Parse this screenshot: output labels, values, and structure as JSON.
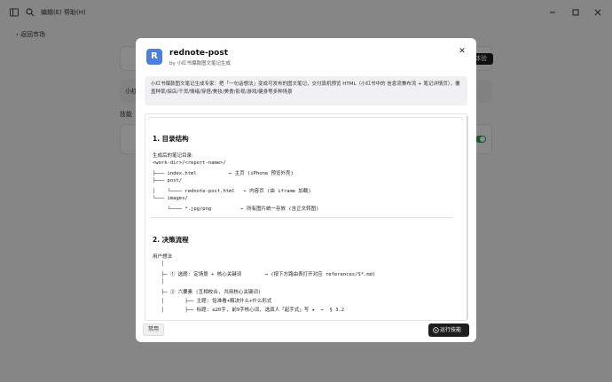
{
  "titlebar": {
    "menu_edit": "编辑(E)",
    "menu_help": "帮助(H)"
  },
  "page": {
    "back_label": "返回市场",
    "desc_fragment": "小红",
    "section_skills": "技能",
    "try_button": "体验"
  },
  "modal": {
    "avatar_letter": "R",
    "title": "rednote-post",
    "subtitle": "by 小红书爆款图文笔记生成",
    "description": "小红书爆款图文笔记生成专家：把「一句话想法」变成可发布的图文笔记，交付真机预览 HTML（小红书中的 信息流兼布流 + 笔记详情页），覆盖种草/探店/干货/情绪/穿搭/美妆/美食/影视/游戏/健身等多种场景",
    "section1_title": "1. 目录结构",
    "tree_intro": "生成后的笔记目录:",
    "tree_lines": [
      "<work-dir>/<report-name>/",
      "├─── index.html           ← 主页 (iPhone 预览外壳)",
      "├─── post/",
      "│    └──── rednote-post.html   ← 内容页 (由 iframe 加载)",
      "└─── images/",
      "     └──── *.jpg/png          ← 所有图片统一存放 (含正文转图)"
    ],
    "section2_title": "2. 决策流程",
    "flow_intro": "用户想法",
    "flow_lines": [
      "   │",
      "   ├─ ① 选题: 定场景 + 核心关键词        → (按下方路由表打开对应 references/S*.md)",
      "   │",
      "   ├─ ② 六要素 (互相校合, 共用核心关键词)",
      "   │       ├── 主题: 恰准看+解决什么+什么形式",
      "   │       ├── 标题: ≤20字, 前9字核心词, 选真人「起手式」写 ★  →  § 3.2"
    ],
    "disable_label": "禁用",
    "run_label": "运行技能"
  }
}
